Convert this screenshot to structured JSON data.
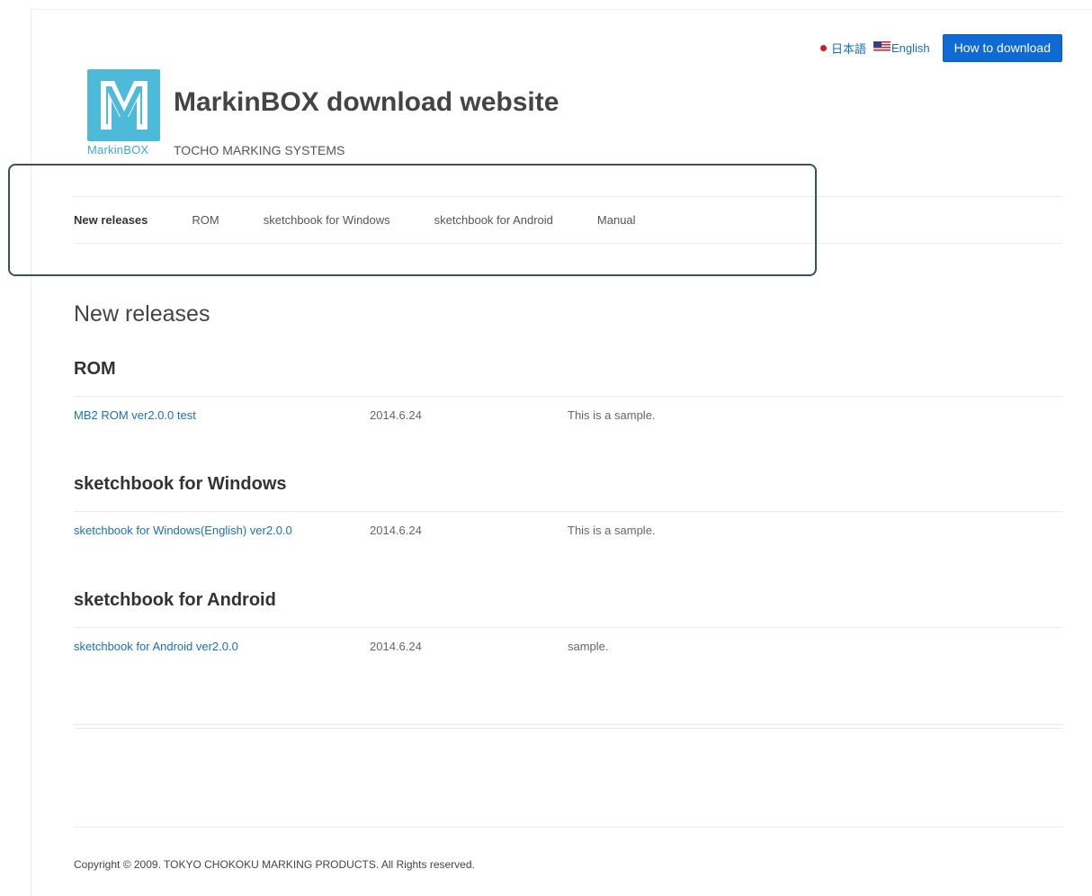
{
  "languages": {
    "japanese_label": "日本語",
    "english_label": "English"
  },
  "header": {
    "download_button": "How to download",
    "logo_text": "MarkinBOX",
    "title": "MarkinBOX download website",
    "subtitle": "TOCHO MARKING SYSTEMS",
    "logo_color": "#4cbad8"
  },
  "nav": {
    "items": [
      {
        "label": "New releases"
      },
      {
        "label": "ROM"
      },
      {
        "label": "sketchbook for Windows"
      },
      {
        "label": "sketchbook for Android"
      },
      {
        "label": "Manual"
      }
    ]
  },
  "main": {
    "heading": "New releases",
    "sections": [
      {
        "title": "ROM",
        "rows": [
          {
            "name": "MB2 ROM ver2.0.0 test",
            "date": "2014.6.24",
            "note": "This is a sample."
          }
        ]
      },
      {
        "title": "sketchbook for Windows",
        "rows": [
          {
            "name": "sketchbook for Windows(English) ver2.0.0",
            "date": "2014.6.24",
            "note": "This is a sample."
          }
        ]
      },
      {
        "title": "sketchbook for Android",
        "rows": [
          {
            "name": "sketchbook for Android ver2.0.0",
            "date": "2014.6.24",
            "note": "sample."
          }
        ]
      }
    ]
  },
  "footer": {
    "copyright": "Copyright © 2009. TOKYO CHOKOKU MARKING PRODUCTS. All Rights reserved."
  },
  "colors": {
    "accent": "#0f6ad6",
    "link": "#1a6fbf"
  }
}
